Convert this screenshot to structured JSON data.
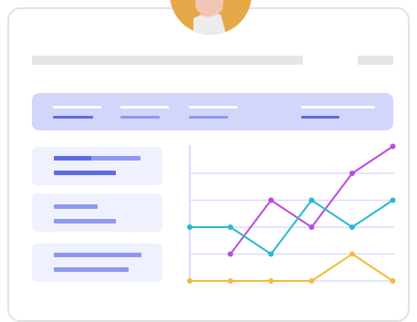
{
  "colors": {
    "accent": "#5f6ce0",
    "accent_light": "#8f98ef",
    "panel": "#d2d6fb",
    "list_card": "#f0f1fe",
    "avatar_bg": "#e7a84a",
    "series_purple": "#b84de0",
    "series_cyan": "#2bb8cf",
    "series_yellow": "#f0bd3c"
  },
  "avatar": {
    "icon": "user-avatar"
  },
  "chart_data": {
    "type": "line",
    "x": [
      1,
      2,
      3,
      4,
      5,
      6,
      7
    ],
    "grid": true,
    "legend": "none",
    "series": [
      {
        "values": [
          null,
          1,
          3,
          2,
          4,
          5
        ],
        "color": "#b84de0"
      },
      {
        "values": [
          2,
          2,
          1,
          3,
          2,
          3
        ],
        "color": "#2bb8cf"
      },
      {
        "values": [
          0,
          0,
          0,
          0,
          1,
          0
        ],
        "color": "#f0bd3c"
      }
    ]
  }
}
